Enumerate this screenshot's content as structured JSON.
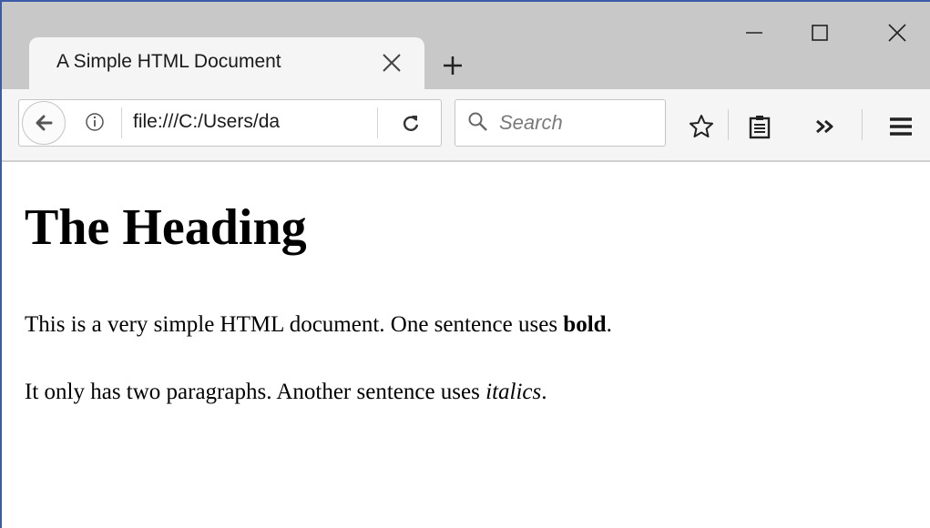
{
  "browser": {
    "tab": {
      "title": "A Simple HTML Document"
    },
    "toolbar": {
      "url": "file:///C:/Users/da",
      "search_placeholder": "Search",
      "icons": [
        "back-arrow-icon",
        "info-icon",
        "reload-icon",
        "search-icon",
        "bookmark-star-icon",
        "reader-view-icon",
        "overflow-chevron-icon",
        "hamburger-menu-icon"
      ]
    },
    "window_controls": [
      "minimize-icon",
      "maximize-icon",
      "close-icon"
    ]
  },
  "page": {
    "heading": "The Heading",
    "paragraph1": {
      "text": "This is a very simple HTML document. One sentence uses ",
      "emphasis": "bold",
      "end": "."
    },
    "paragraph2": {
      "text": "It only has two paragraphs. Another sentence uses ",
      "emphasis": "italics",
      "end": "."
    }
  },
  "colors": {
    "tabstrip": "#c8c8c8",
    "toolbar": "#f5f5f5",
    "window_border": "#3b5aa8"
  }
}
